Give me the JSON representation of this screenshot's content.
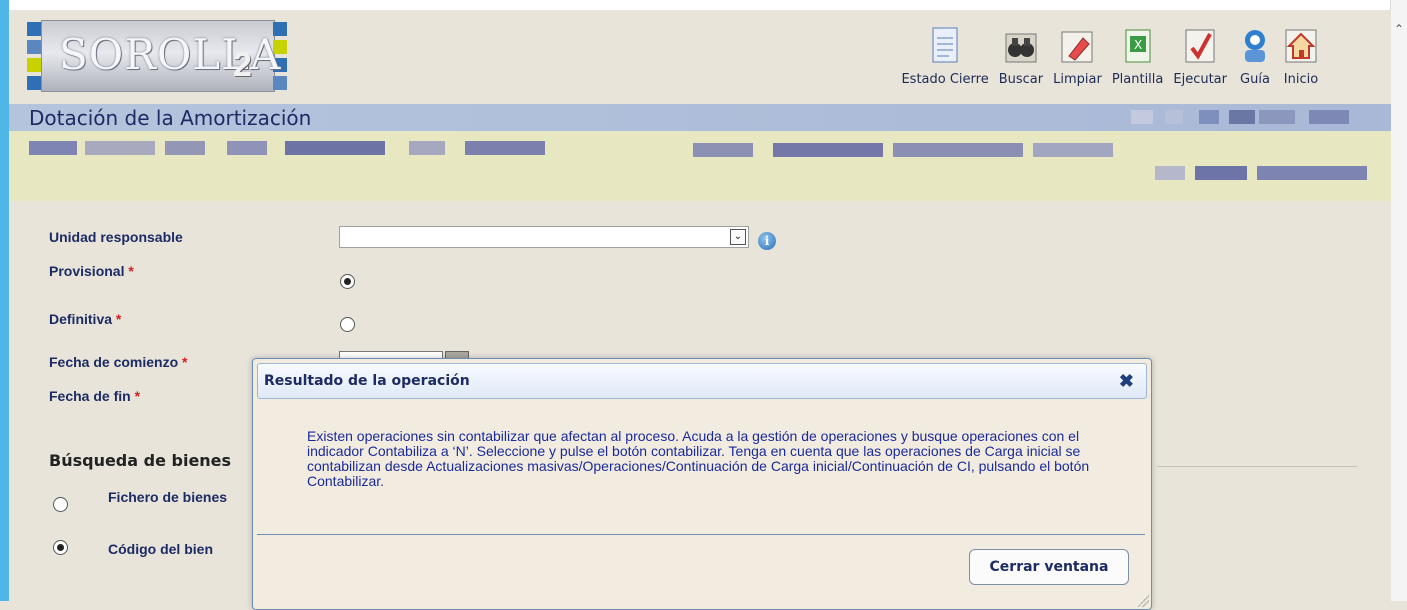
{
  "app": {
    "logo_text": "SOROLLA",
    "logo_num": "2"
  },
  "toolbar": {
    "items": [
      {
        "label": "Estado Cierre",
        "icon": "document-icon"
      },
      {
        "label": "Buscar",
        "icon": "binoculars-icon"
      },
      {
        "label": "Limpiar",
        "icon": "eraser-icon"
      },
      {
        "label": "Plantilla",
        "icon": "spreadsheet-icon"
      },
      {
        "label": "Ejecutar",
        "icon": "checkmark-icon"
      },
      {
        "label": "Guía",
        "icon": "help-person-icon"
      },
      {
        "label": "Inicio",
        "icon": "home-icon"
      }
    ]
  },
  "page": {
    "title": "Dotación de la Amortización"
  },
  "form": {
    "unidad_label": "Unidad responsable",
    "unidad_value": "",
    "provisional_label": "Provisional",
    "definitiva_label": "Definitiva",
    "fecha_comienzo_label": "Fecha de comienzo",
    "fecha_fin_label": "Fecha de fin",
    "required_mark": "*",
    "provisional_selected": true,
    "definitiva_selected": false
  },
  "busqueda": {
    "title": "Búsqueda de bienes",
    "fichero_label": "Fichero de bienes",
    "codigo_label": "Código del bien",
    "fichero_selected": false,
    "codigo_selected": true
  },
  "modal": {
    "title": "Resultado de la operación",
    "message": "Existen operaciones sin contabilizar que afectan al proceso. Acuda a la gestión de operaciones y busque operaciones con el indicador Contabiliza a ‘N’. Seleccione y pulse el botón contabilizar. Tenga en cuenta que las operaciones de Carga inicial se contabilizan desde Actualizaciones masivas/Operaciones/Continuación de Carga inicial/Continuación de CI, pulsando el botón Contabilizar.",
    "close_button": "Cerrar ventana"
  },
  "colors": {
    "accent": "#4fb6e8",
    "title_band": "#a8b8d6",
    "info_band": "#e7e8c2",
    "text_primary": "#1c2b64"
  }
}
